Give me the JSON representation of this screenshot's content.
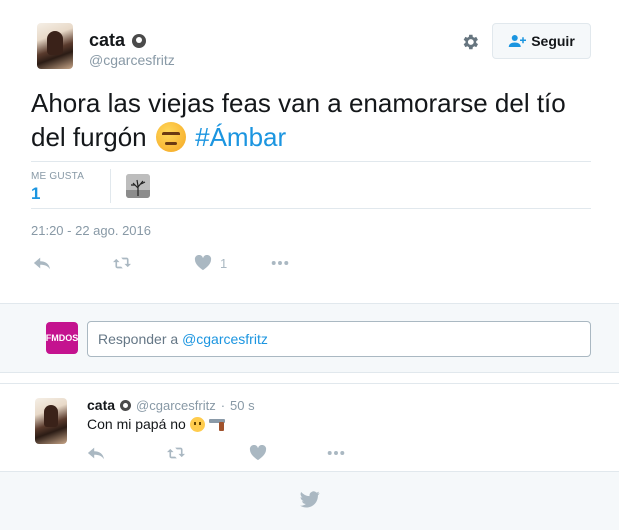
{
  "tweet": {
    "name": "cata",
    "handle": "@cgarcesfritz",
    "follow_label": "Seguir",
    "text_main": "Ahora las viejas feas van a enamorarse del tío del furgón",
    "hashtag": "#Ámbar",
    "stats": {
      "likes_label": "ME GUSTA",
      "likes_value": "1"
    },
    "timestamp": "21:20 - 22 ago. 2016",
    "actions": {
      "like_count": "1"
    }
  },
  "reply_box": {
    "self_avatar_text": "FMDOS",
    "placeholder_prefix": "Responder a",
    "placeholder_handle": "@cgarcesfritz"
  },
  "reply": {
    "name": "cata",
    "handle": "@cgarcesfritz",
    "separator": "·",
    "time": "50 s",
    "text": "Con mi papá no"
  },
  "colors": {
    "link": "#1b95e0",
    "muted": "#8899a6",
    "icon": "#aab8c2",
    "background_alt": "#f5f8fa"
  },
  "icons": [
    "verified-icon",
    "gear-icon",
    "add-user-icon",
    "reply-icon",
    "retweet-icon",
    "heart-icon",
    "more-icon",
    "twitter-bird-icon"
  ]
}
